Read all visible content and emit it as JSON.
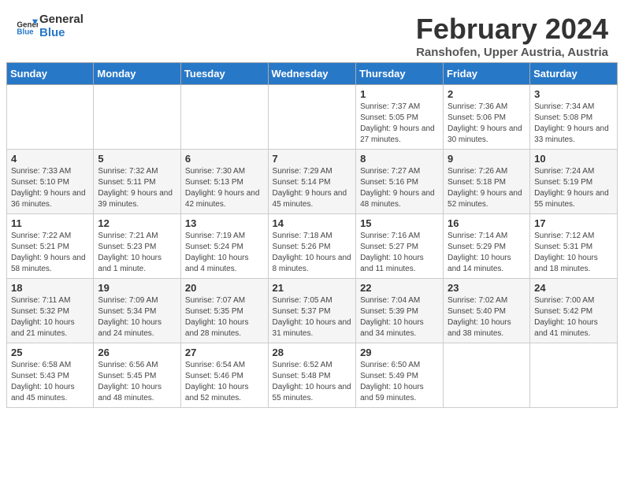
{
  "header": {
    "logo_line1": "General",
    "logo_line2": "Blue",
    "month_title": "February 2024",
    "location": "Ranshofen, Upper Austria, Austria"
  },
  "days_of_week": [
    "Sunday",
    "Monday",
    "Tuesday",
    "Wednesday",
    "Thursday",
    "Friday",
    "Saturday"
  ],
  "weeks": [
    [
      {
        "day": "",
        "info": ""
      },
      {
        "day": "",
        "info": ""
      },
      {
        "day": "",
        "info": ""
      },
      {
        "day": "",
        "info": ""
      },
      {
        "day": "1",
        "info": "Sunrise: 7:37 AM\nSunset: 5:05 PM\nDaylight: 9 hours and 27 minutes."
      },
      {
        "day": "2",
        "info": "Sunrise: 7:36 AM\nSunset: 5:06 PM\nDaylight: 9 hours and 30 minutes."
      },
      {
        "day": "3",
        "info": "Sunrise: 7:34 AM\nSunset: 5:08 PM\nDaylight: 9 hours and 33 minutes."
      }
    ],
    [
      {
        "day": "4",
        "info": "Sunrise: 7:33 AM\nSunset: 5:10 PM\nDaylight: 9 hours and 36 minutes."
      },
      {
        "day": "5",
        "info": "Sunrise: 7:32 AM\nSunset: 5:11 PM\nDaylight: 9 hours and 39 minutes."
      },
      {
        "day": "6",
        "info": "Sunrise: 7:30 AM\nSunset: 5:13 PM\nDaylight: 9 hours and 42 minutes."
      },
      {
        "day": "7",
        "info": "Sunrise: 7:29 AM\nSunset: 5:14 PM\nDaylight: 9 hours and 45 minutes."
      },
      {
        "day": "8",
        "info": "Sunrise: 7:27 AM\nSunset: 5:16 PM\nDaylight: 9 hours and 48 minutes."
      },
      {
        "day": "9",
        "info": "Sunrise: 7:26 AM\nSunset: 5:18 PM\nDaylight: 9 hours and 52 minutes."
      },
      {
        "day": "10",
        "info": "Sunrise: 7:24 AM\nSunset: 5:19 PM\nDaylight: 9 hours and 55 minutes."
      }
    ],
    [
      {
        "day": "11",
        "info": "Sunrise: 7:22 AM\nSunset: 5:21 PM\nDaylight: 9 hours and 58 minutes."
      },
      {
        "day": "12",
        "info": "Sunrise: 7:21 AM\nSunset: 5:23 PM\nDaylight: 10 hours and 1 minute."
      },
      {
        "day": "13",
        "info": "Sunrise: 7:19 AM\nSunset: 5:24 PM\nDaylight: 10 hours and 4 minutes."
      },
      {
        "day": "14",
        "info": "Sunrise: 7:18 AM\nSunset: 5:26 PM\nDaylight: 10 hours and 8 minutes."
      },
      {
        "day": "15",
        "info": "Sunrise: 7:16 AM\nSunset: 5:27 PM\nDaylight: 10 hours and 11 minutes."
      },
      {
        "day": "16",
        "info": "Sunrise: 7:14 AM\nSunset: 5:29 PM\nDaylight: 10 hours and 14 minutes."
      },
      {
        "day": "17",
        "info": "Sunrise: 7:12 AM\nSunset: 5:31 PM\nDaylight: 10 hours and 18 minutes."
      }
    ],
    [
      {
        "day": "18",
        "info": "Sunrise: 7:11 AM\nSunset: 5:32 PM\nDaylight: 10 hours and 21 minutes."
      },
      {
        "day": "19",
        "info": "Sunrise: 7:09 AM\nSunset: 5:34 PM\nDaylight: 10 hours and 24 minutes."
      },
      {
        "day": "20",
        "info": "Sunrise: 7:07 AM\nSunset: 5:35 PM\nDaylight: 10 hours and 28 minutes."
      },
      {
        "day": "21",
        "info": "Sunrise: 7:05 AM\nSunset: 5:37 PM\nDaylight: 10 hours and 31 minutes."
      },
      {
        "day": "22",
        "info": "Sunrise: 7:04 AM\nSunset: 5:39 PM\nDaylight: 10 hours and 34 minutes."
      },
      {
        "day": "23",
        "info": "Sunrise: 7:02 AM\nSunset: 5:40 PM\nDaylight: 10 hours and 38 minutes."
      },
      {
        "day": "24",
        "info": "Sunrise: 7:00 AM\nSunset: 5:42 PM\nDaylight: 10 hours and 41 minutes."
      }
    ],
    [
      {
        "day": "25",
        "info": "Sunrise: 6:58 AM\nSunset: 5:43 PM\nDaylight: 10 hours and 45 minutes."
      },
      {
        "day": "26",
        "info": "Sunrise: 6:56 AM\nSunset: 5:45 PM\nDaylight: 10 hours and 48 minutes."
      },
      {
        "day": "27",
        "info": "Sunrise: 6:54 AM\nSunset: 5:46 PM\nDaylight: 10 hours and 52 minutes."
      },
      {
        "day": "28",
        "info": "Sunrise: 6:52 AM\nSunset: 5:48 PM\nDaylight: 10 hours and 55 minutes."
      },
      {
        "day": "29",
        "info": "Sunrise: 6:50 AM\nSunset: 5:49 PM\nDaylight: 10 hours and 59 minutes."
      },
      {
        "day": "",
        "info": ""
      },
      {
        "day": "",
        "info": ""
      }
    ]
  ]
}
